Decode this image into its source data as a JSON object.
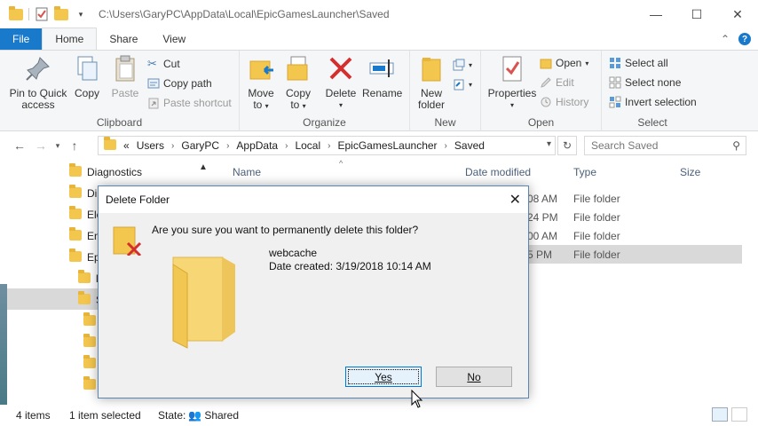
{
  "window": {
    "title_path": "C:\\Users\\GaryPC\\AppData\\Local\\EpicGamesLauncher\\Saved",
    "controls": [
      "minimize",
      "maximize",
      "close"
    ]
  },
  "ribbon_tabs": [
    {
      "label": "File"
    },
    {
      "label": "Home"
    },
    {
      "label": "Share"
    },
    {
      "label": "View"
    }
  ],
  "ribbon": {
    "clipboard": {
      "label": "Clipboard",
      "pin": "Pin to Quick access",
      "pin_l1": "Pin to Quick",
      "pin_l2": "access",
      "copy": "Copy",
      "paste": "Paste",
      "cut": "Cut",
      "copy_path": "Copy path",
      "paste_shortcut": "Paste shortcut"
    },
    "organize": {
      "label": "Organize",
      "move_to_l1": "Move",
      "move_to_l2": "to",
      "copy_to_l1": "Copy",
      "copy_to_l2": "to",
      "delete": "Delete",
      "rename": "Rename"
    },
    "new": {
      "label": "New",
      "new_folder_l1": "New",
      "new_folder_l2": "folder"
    },
    "open": {
      "label": "Open",
      "properties": "Properties",
      "open": "Open",
      "edit": "Edit",
      "history": "History"
    },
    "select": {
      "label": "Select",
      "select_all": "Select all",
      "select_none": "Select none",
      "invert": "Invert selection"
    }
  },
  "address": {
    "crumbs": [
      "«",
      "Users",
      "GaryPC",
      "AppData",
      "Local",
      "EpicGamesLauncher",
      "Saved"
    ],
    "search_placeholder": "Search Saved"
  },
  "tree": {
    "items": [
      "Diagnostics",
      "Di",
      "Ele",
      "En",
      "Ep",
      "l",
      "S"
    ]
  },
  "columns": {
    "name": "Name",
    "date": "Date modified",
    "type": "Type",
    "size": "Size"
  },
  "rows": [
    {
      "date": "08 AM",
      "type": "File folder"
    },
    {
      "date": "24 PM",
      "type": "File folder"
    },
    {
      "date": "00 AM",
      "type": "File folder"
    },
    {
      "date": "5 PM",
      "type": "File folder"
    }
  ],
  "status": {
    "items": "4 items",
    "selected": "1 item selected",
    "state_label": "State:",
    "state_value": "Shared"
  },
  "dialog": {
    "title": "Delete Folder",
    "question": "Are you sure you want to permanently delete this folder?",
    "folder_name": "webcache",
    "date_created": "Date created: 3/19/2018 10:14 AM",
    "yes": "Yes",
    "no": "No"
  },
  "colors": {
    "accent": "#1979ca",
    "folder": "#f3c64e",
    "delete_red": "#d32f2f"
  }
}
